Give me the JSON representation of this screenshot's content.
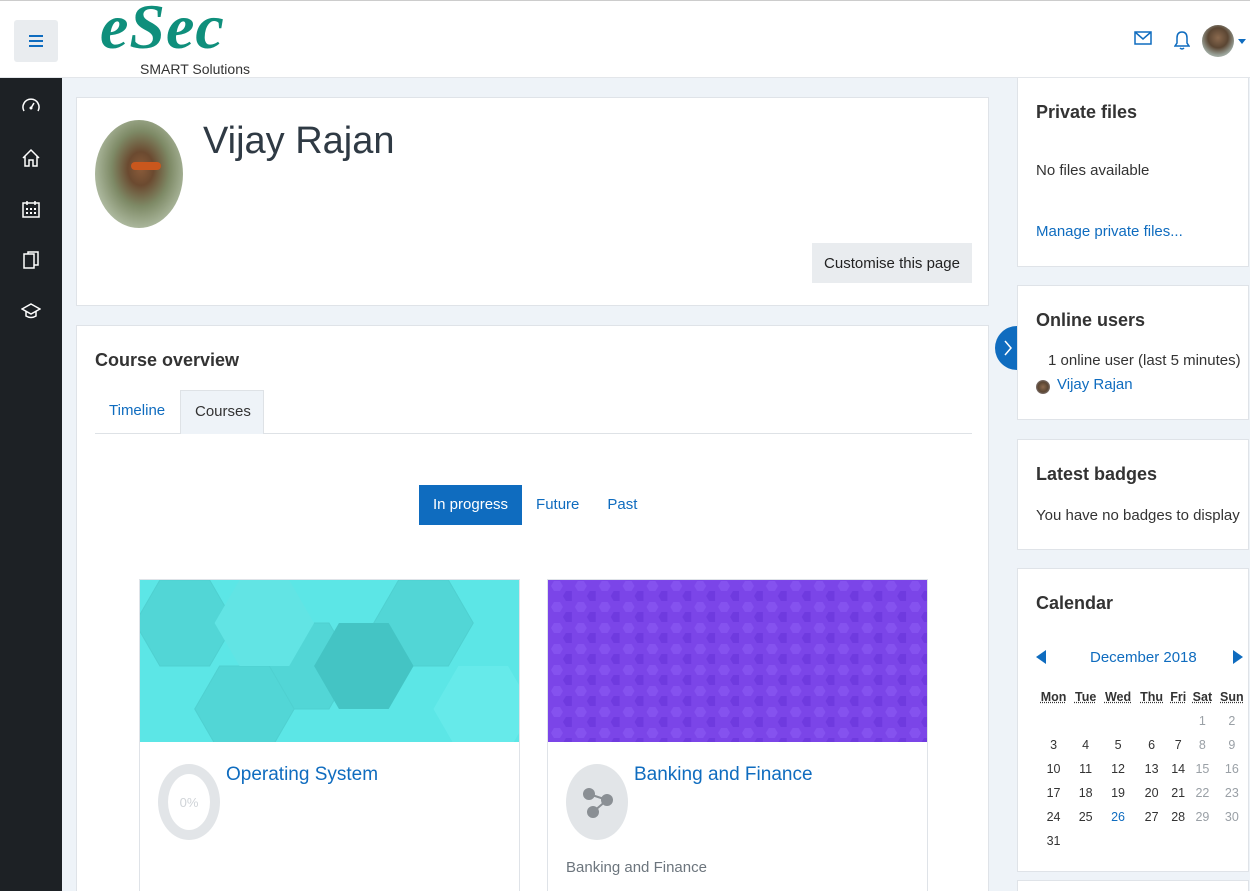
{
  "header": {
    "logo_text": "eSec",
    "logo_subtitle": "SMART Solutions",
    "icons": [
      "menu-icon",
      "mail-icon",
      "bell-icon",
      "user-avatar",
      "caret-down-icon"
    ]
  },
  "sidebar": {
    "items": [
      {
        "icon": "dashboard-icon",
        "label": "Dashboard"
      },
      {
        "icon": "home-icon",
        "label": "Site home"
      },
      {
        "icon": "calendar-icon",
        "label": "Calendar"
      },
      {
        "icon": "files-icon",
        "label": "Private files"
      },
      {
        "icon": "graduation-cap-icon",
        "label": "My courses"
      }
    ]
  },
  "profile": {
    "name": "Vijay Rajan",
    "customise_label": "Customise this page"
  },
  "course_overview": {
    "title": "Course overview",
    "tabs": [
      {
        "label": "Timeline",
        "active": false
      },
      {
        "label": "Courses",
        "active": true
      }
    ],
    "filters": [
      {
        "label": "In progress",
        "active": true
      },
      {
        "label": "Future",
        "active": false
      },
      {
        "label": "Past",
        "active": false
      }
    ],
    "courses": [
      {
        "name": "Operating System",
        "progress_label": "0%",
        "progress": 0,
        "category": ""
      },
      {
        "name": "Banking and Finance",
        "progress_label": "",
        "category": "Banking and Finance"
      }
    ]
  },
  "right_blocks": {
    "private_files": {
      "title": "Private files",
      "empty_text": "No files available",
      "manage_link": "Manage private files..."
    },
    "online_users": {
      "title": "Online users",
      "summary": "1 online user (last 5 minutes)",
      "users": [
        "Vijay Rajan"
      ]
    },
    "latest_badges": {
      "title": "Latest badges",
      "empty_text": "You have no badges to display"
    },
    "calendar": {
      "title": "Calendar",
      "month": "December 2018",
      "weekdays": [
        "Mon",
        "Tue",
        "Wed",
        "Thu",
        "Fri",
        "Sat",
        "Sun"
      ],
      "weeks": [
        [
          "",
          "",
          "",
          "",
          "",
          "1",
          "2"
        ],
        [
          "3",
          "4",
          "5",
          "6",
          "7",
          "8",
          "9"
        ],
        [
          "10",
          "11",
          "12",
          "13",
          "14",
          "15",
          "16"
        ],
        [
          "17",
          "18",
          "19",
          "20",
          "21",
          "22",
          "23"
        ],
        [
          "24",
          "25",
          "26",
          "27",
          "28",
          "29",
          "30"
        ],
        [
          "31",
          "",
          "",
          "",
          "",
          "",
          ""
        ]
      ],
      "today": "26"
    }
  },
  "colors": {
    "primary": "#0f6cbf",
    "sidebar_bg": "#1d2125",
    "logo_green": "#0f8f7c",
    "teal_course": "#5ce6e6",
    "purple_course": "#7b45e8"
  }
}
